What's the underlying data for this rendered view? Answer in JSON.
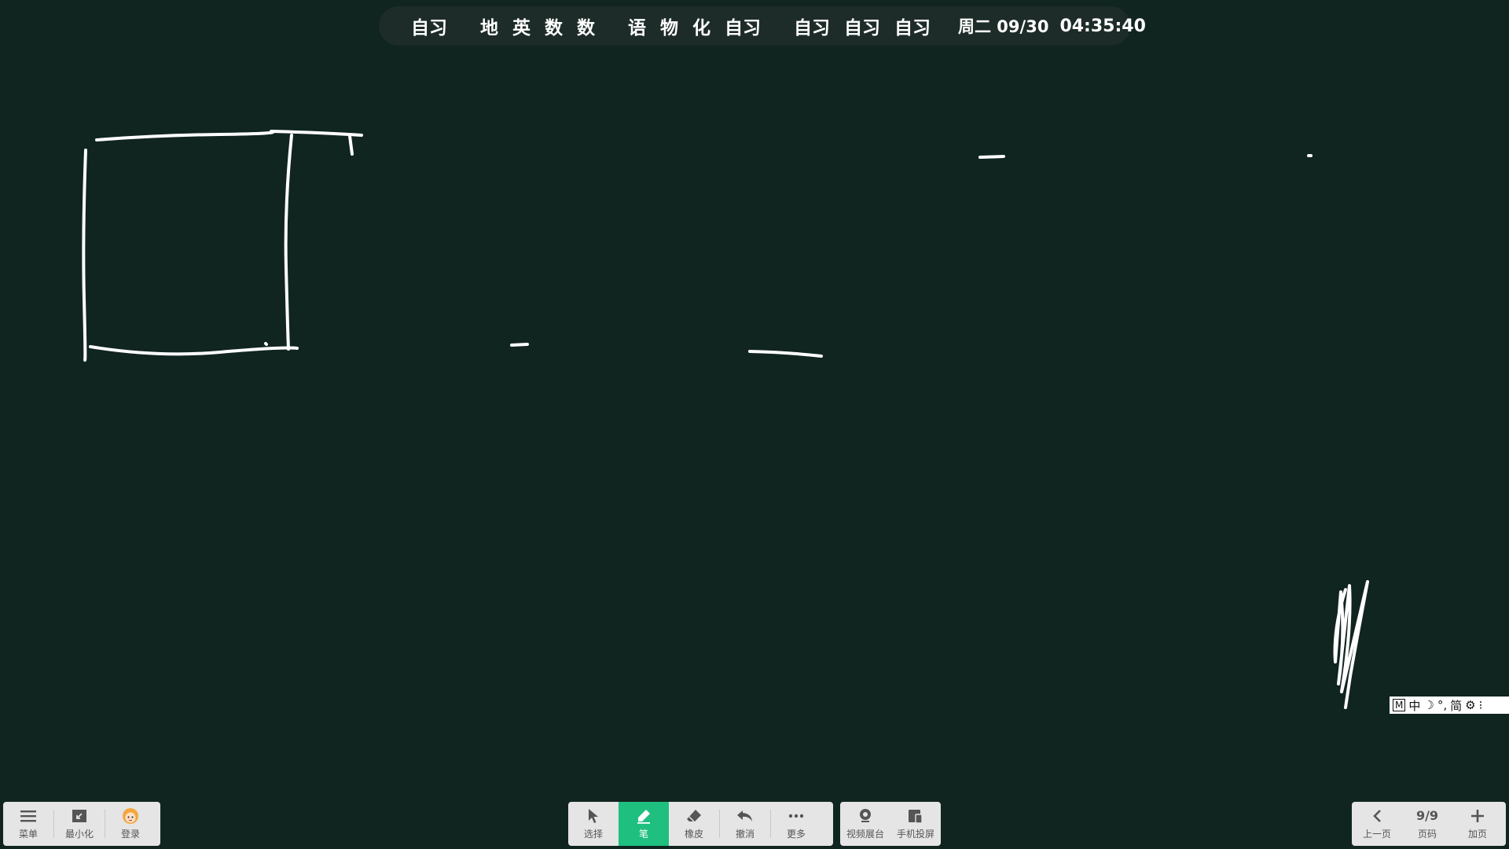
{
  "schedule": {
    "groups": [
      [
        "自习"
      ],
      [
        "地",
        "英",
        "数",
        "数"
      ],
      [
        "语",
        "物",
        "化",
        "自习"
      ],
      [
        "自习",
        "自习",
        "自习"
      ]
    ],
    "date": "周二 09/30",
    "time": "04:35:40"
  },
  "ime": {
    "mode_badge": "M",
    "language": "中",
    "moon_icon": "moon-icon",
    "punctuation": "°,",
    "script": "简",
    "settings_icon": "gear-icon",
    "more": "⁝"
  },
  "toolbar_left": {
    "menu_label": "菜单",
    "minimize_label": "最小化",
    "login_label": "登录"
  },
  "toolbar_center": {
    "select_label": "选择",
    "pen_label": "笔",
    "eraser_label": "橡皮",
    "undo_label": "撤消",
    "more_label": "更多"
  },
  "toolbar_media": {
    "video_booth_label": "视频展台",
    "phone_cast_label": "手机投屏"
  },
  "toolbar_right": {
    "prev_label": "上一页",
    "page_number": "9/9",
    "page_label": "页码",
    "add_page_label": "加页"
  },
  "colors": {
    "board_background": "#112520",
    "stroke": "#ffffff",
    "active_tool": "#1fbf7f",
    "toolbar_background": "#e5e5e5"
  },
  "active_tool": "pen"
}
